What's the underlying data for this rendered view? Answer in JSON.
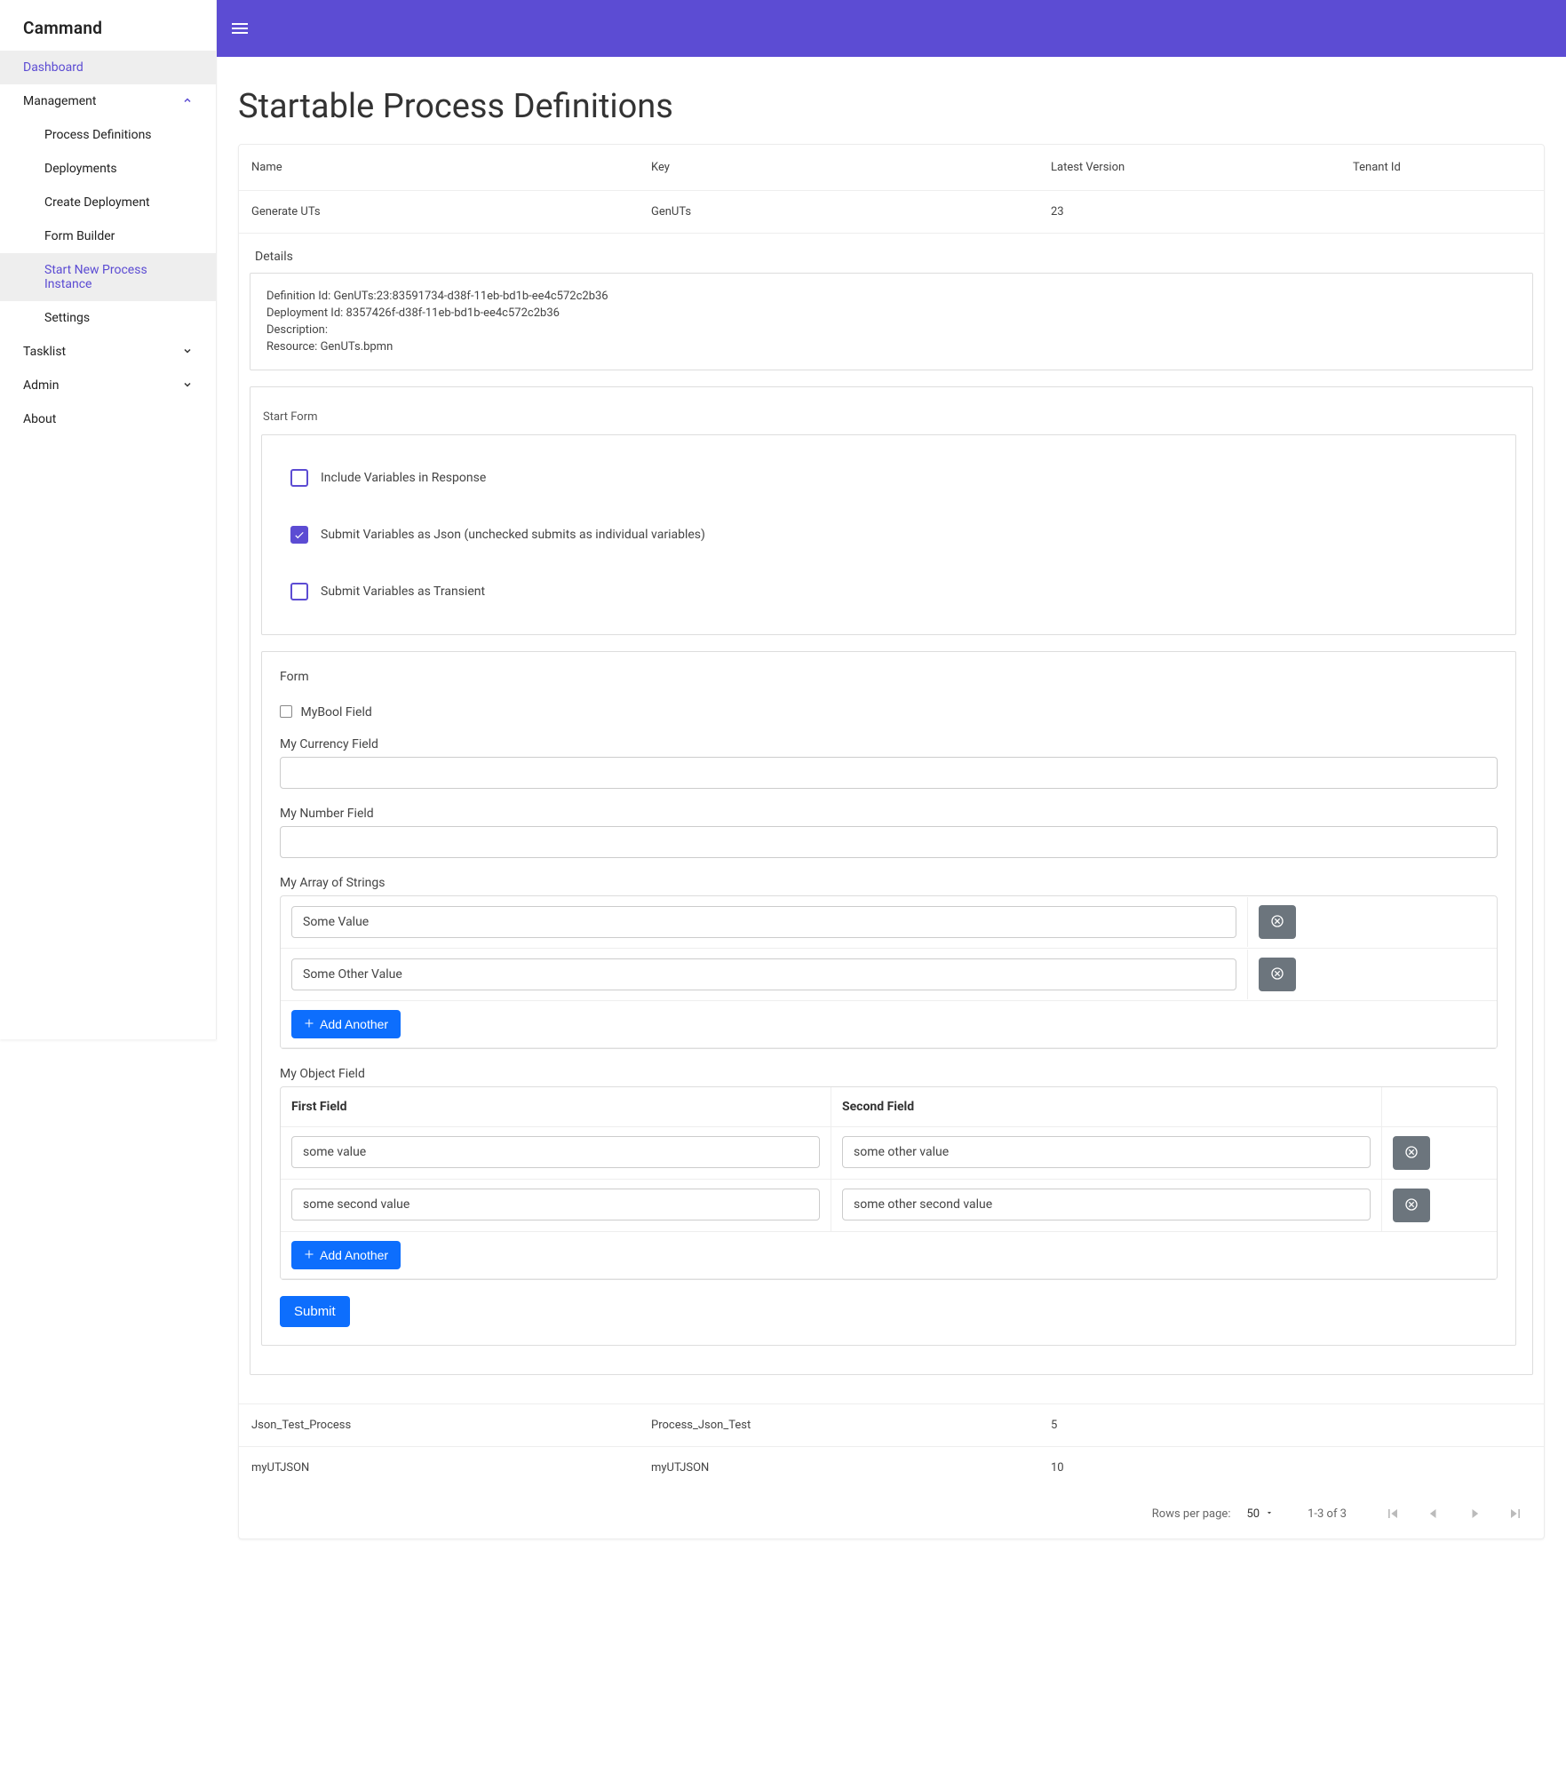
{
  "brand": "Cammand",
  "sidebar": {
    "dashboard": "Dashboard",
    "management": {
      "label": "Management",
      "items": [
        "Process Definitions",
        "Deployments",
        "Create Deployment",
        "Form Builder",
        "Start New Process Instance",
        "Settings"
      ]
    },
    "tasklist": "Tasklist",
    "admin": "Admin",
    "about": "About"
  },
  "page": {
    "title": "Startable Process Definitions"
  },
  "table": {
    "headers": {
      "name": "Name",
      "key": "Key",
      "version": "Latest Version",
      "tenant": "Tenant Id"
    },
    "rows": [
      {
        "name": "Generate UTs",
        "key": "GenUTs",
        "version": "23",
        "tenant": ""
      }
    ],
    "other_rows": [
      {
        "name": "Json_Test_Process",
        "key": "Process_Json_Test",
        "version": "5",
        "tenant": ""
      },
      {
        "name": "myUTJSON",
        "key": "myUTJSON",
        "version": "10",
        "tenant": ""
      }
    ]
  },
  "details": {
    "title": "Details",
    "definition_id_label": "Definition Id: ",
    "definition_id": "GenUTs:23:83591734-d38f-11eb-bd1b-ee4c572c2b36",
    "deployment_id_label": "Deployment Id: ",
    "deployment_id": "8357426f-d38f-11eb-bd1b-ee4c572c2b36",
    "description_label": "Description:",
    "description": "",
    "resource_label": "Resource: ",
    "resource": "GenUTs.bpmn"
  },
  "start_form": {
    "label": "Start Form",
    "opts": {
      "include_vars": "Include Variables in Response",
      "as_json": "Submit Variables as Json (unchecked submits as individual variables)",
      "transient": "Submit Variables as Transient"
    },
    "form": {
      "title": "Form",
      "bool_label": "MyBool Field",
      "currency_label": "My Currency Field",
      "number_label": "My Number Field",
      "array_label": "My Array of Strings",
      "array_values": [
        "Some Value",
        "Some Other Value"
      ],
      "object_label": "My Object Field",
      "object_headers": {
        "f1": "First Field",
        "f2": "Second Field"
      },
      "object_rows": [
        {
          "f1": "some value",
          "f2": "some other value"
        },
        {
          "f1": "some second value",
          "f2": "some other second value"
        }
      ],
      "add_another": "Add Another",
      "submit": "Submit"
    }
  },
  "pager": {
    "rows_label": "Rows per page:",
    "rows_value": "50",
    "caption": "1-3 of 3"
  }
}
